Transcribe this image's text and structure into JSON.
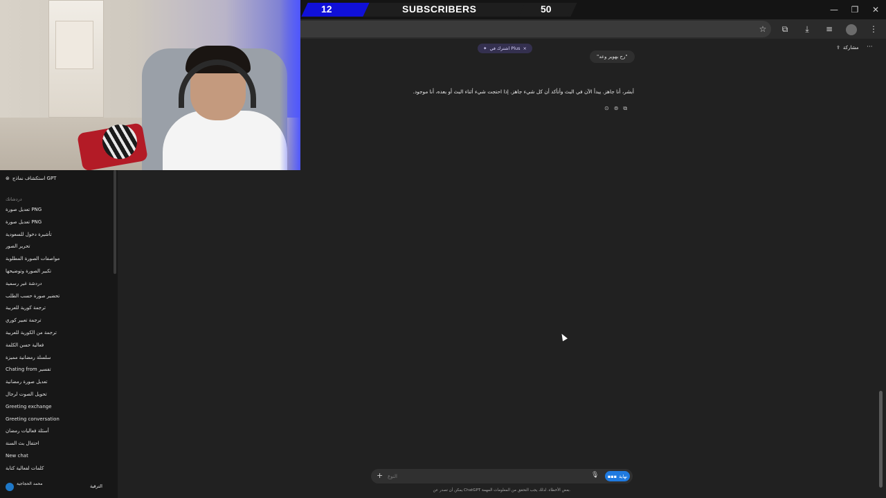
{
  "overlay": {
    "sub_left": "12",
    "sub_title": "SUBSCRIBERS",
    "sub_right": "50"
  },
  "window_controls": [
    "—",
    "❐",
    "✕"
  ],
  "toolbar_icons": [
    "star-icon",
    "extensions-icon",
    "download-icon",
    "media-icon",
    "profile-icon",
    "menu-icon"
  ],
  "toolbar_glyphs": {
    "star": "☆",
    "ext": "⧉",
    "download": "⤓",
    "media": "≡",
    "menu": "⋮"
  },
  "sidebar": {
    "explore_label": "استكشاف نماذج GPT",
    "explore_glyph": "⊛",
    "section_label": "دردشاتك",
    "items": [
      "تعديل صورة PNG",
      "تعديل صورة PNG",
      "تأشيرة دخول للسعودية",
      "تحرير الصور",
      "مواصفات الصورة المطلوبة",
      "تكبير الصورة وتوضيحها",
      "دردشة غير رسمية",
      "تحضير صورة حسب الطلب",
      "ترجمة كورية للعربية",
      "ترجمة تعبير كوري",
      "ترجمة من الكورية للعربية",
      "فعالية حسن الكلمة",
      "سلسلة رمضانية مميزة",
      "Chating from تفسير",
      "تعديل صورة رمضانية",
      "تحويل الصوت لرجال",
      "Greeting exchange",
      "Greeting conversation",
      "أسئلة فعاليات رمضان",
      "احتفال بث السنة",
      "New chat",
      "كلمات لفعالية كتابة"
    ],
    "user_name": "محمد الحجاجية",
    "upgrade_label": "الترقية"
  },
  "main": {
    "plus_pill": "اشترك في Plus",
    "plus_close": "×",
    "plus_glyph": "✦",
    "share_label": "مشاركة",
    "share_glyph": "⇪",
    "more_glyph": "···",
    "user_message": "\"رح بهوير وعد\"",
    "assistant_message": "أبشر، أنا جاهز. يبدأ الآن في البث وأتأكد أن كل شيء جاهز. إذا احتجت شيء أثناء البث أو بعده، أنا موجود.",
    "actions": [
      "⊙",
      "⊚",
      "⧉"
    ],
    "composer_placeholder": "النوع",
    "composer_plus": "+",
    "composer_mic": "🎙",
    "send_label": "نهاية",
    "send_glyph": "▪▪▪",
    "disclaimer": "يمكن أن تصدر عن ChatGPT بعض الأخطاء. لذلك يجب التحقق من المعلومات المهمة."
  }
}
